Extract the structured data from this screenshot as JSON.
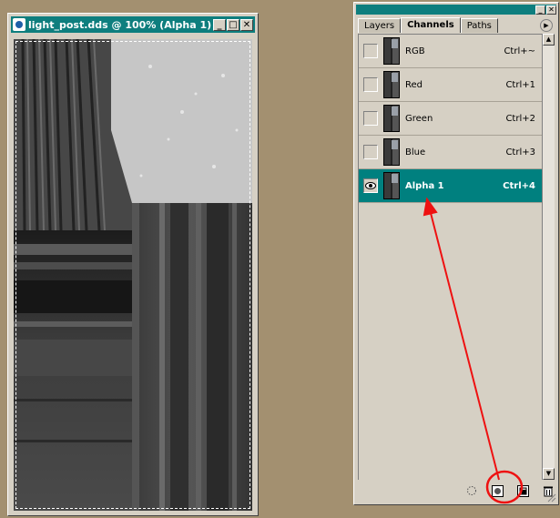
{
  "document": {
    "title": "light_post.dds @ 100% (Alpha 1)",
    "controls": {
      "minimize": "_",
      "maximize": "□",
      "close": "✕"
    }
  },
  "palette": {
    "tabs": [
      {
        "label": "Layers"
      },
      {
        "label": "Channels",
        "active": true
      },
      {
        "label": "Paths"
      }
    ],
    "channels": [
      {
        "name": "RGB",
        "shortcut": "Ctrl+~",
        "visible": false
      },
      {
        "name": "Red",
        "shortcut": "Ctrl+1",
        "visible": false
      },
      {
        "name": "Green",
        "shortcut": "Ctrl+2",
        "visible": false
      },
      {
        "name": "Blue",
        "shortcut": "Ctrl+3",
        "visible": false
      },
      {
        "name": "Alpha 1",
        "shortcut": "Ctrl+4",
        "visible": true,
        "selected": true
      }
    ],
    "footer_icons": [
      "load-selection-icon",
      "save-selection-icon",
      "new-channel-icon",
      "trash-icon"
    ]
  },
  "annotation": {
    "arrow_color": "#ee1111",
    "circle_color": "#ee1111"
  },
  "colors": {
    "desktop": "#a39070",
    "title_bar": "#0e7e7e",
    "selection": "#00807f"
  }
}
